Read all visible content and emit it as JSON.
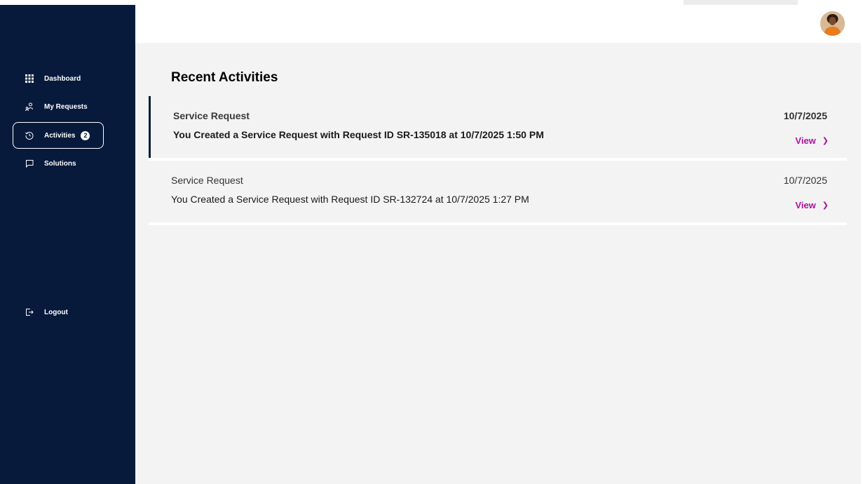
{
  "sidebar": {
    "items": [
      {
        "label": "Dashboard",
        "icon": "grid-icon"
      },
      {
        "label": "My Requests",
        "icon": "user-requests-icon"
      },
      {
        "label": "Activities",
        "icon": "history-icon",
        "badge": "2",
        "active": true
      },
      {
        "label": "Solutions",
        "icon": "chat-icon"
      }
    ],
    "logout": {
      "label": "Logout",
      "icon": "logout-icon"
    }
  },
  "header": {
    "avatar": "user-avatar"
  },
  "main": {
    "title": "Recent Activities",
    "activities": [
      {
        "type": "Service Request",
        "description": "You Created a Service Request with Request ID SR-135018 at 10/7/2025 1:50 PM",
        "date": "10/7/2025",
        "action": "View"
      },
      {
        "type": "Service Request",
        "description": "You Created a Service Request with Request ID SR-132724 at 10/7/2025 1:27 PM",
        "date": "10/7/2025",
        "action": "View"
      }
    ]
  },
  "colors": {
    "sidebar_bg": "#071a3b",
    "accent_link": "#b0129e",
    "content_bg": "#f3f3f3"
  }
}
